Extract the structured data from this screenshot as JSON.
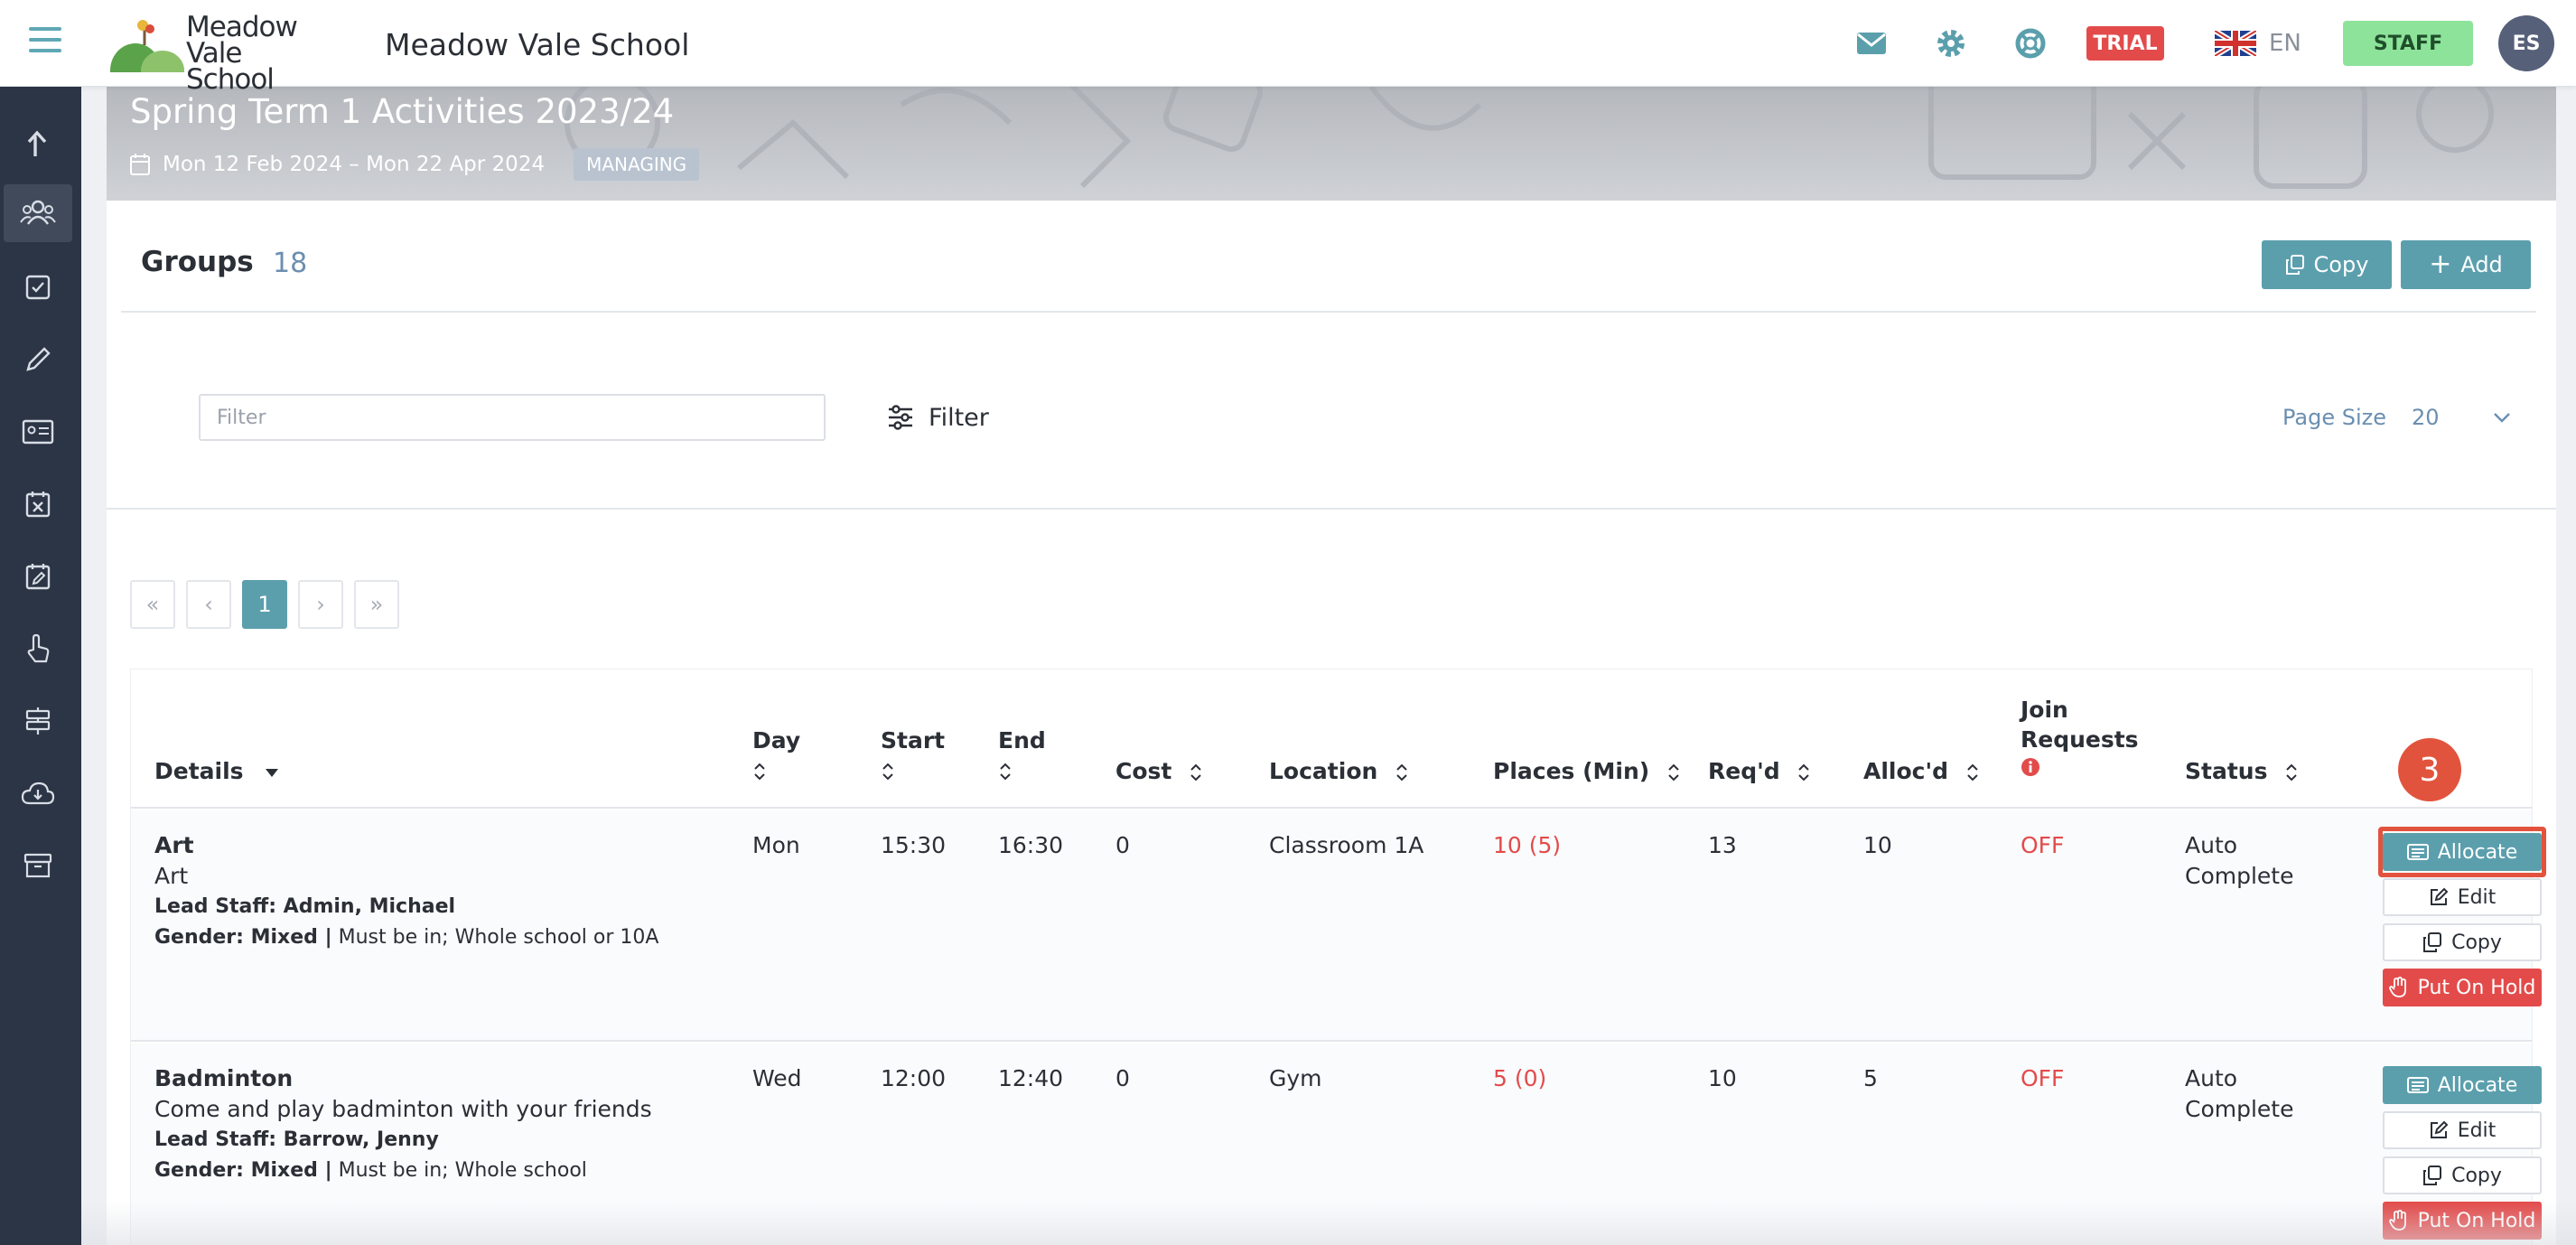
{
  "topbar": {
    "logo_line1": "Meadow",
    "logo_line2": "Vale School",
    "school_name": "Meadow Vale School",
    "trial_label": "TRIAL",
    "language": "EN",
    "staff_label": "STAFF",
    "avatar_initials": "ES"
  },
  "colors": {
    "accent": "#5b9fad",
    "danger": "#e34b4b",
    "sidebar": "#2c3545",
    "staff": "#8ee39b"
  },
  "banner": {
    "title": "Spring Term 1 Activities 2023/24",
    "dates": "Mon 12 Feb 2024 – Mon 22 Apr 2024",
    "badge": "MANAGING"
  },
  "groups": {
    "title": "Groups",
    "count": "18",
    "copy_label": "Copy",
    "add_label": "Add"
  },
  "filter": {
    "placeholder": "Filter",
    "button_label": "Filter",
    "page_size_label": "Page Size",
    "page_size_value": "20"
  },
  "pager": {
    "first": "«",
    "prev": "‹",
    "current": "1",
    "next": "›",
    "last": "»"
  },
  "table": {
    "headers": {
      "details": "Details",
      "day": "Day",
      "start": "Start",
      "end": "End",
      "cost": "Cost",
      "location": "Location",
      "places": "Places (Min)",
      "reqd": "Req'd",
      "allocd": "Alloc'd",
      "join_line1": "Join",
      "join_line2": "Requests",
      "status": "Status"
    },
    "rows": [
      {
        "name": "Art",
        "description": "Art",
        "lead_staff": "Lead Staff: Admin, Michael",
        "gender": "Gender: Mixed |",
        "eligibility": " Must be in; Whole school or 10A",
        "day": "Mon",
        "start": "15:30",
        "end": "16:30",
        "cost": "0",
        "location": "Classroom 1A",
        "places": "10 (5)",
        "reqd": "13",
        "allocd": "10",
        "join": "OFF",
        "status_line1": "Auto",
        "status_line2": "Complete"
      },
      {
        "name": "Badminton",
        "description": "Come and play badminton with your friends",
        "lead_staff": "Lead Staff: Barrow, Jenny",
        "gender": "Gender: Mixed |",
        "eligibility": " Must be in; Whole school",
        "day": "Wed",
        "start": "12:00",
        "end": "12:40",
        "cost": "0",
        "location": "Gym",
        "places": "5 (0)",
        "reqd": "10",
        "allocd": "5",
        "join": "OFF",
        "status_line1": "Auto",
        "status_line2": "Complete"
      }
    ],
    "actions": {
      "allocate": "Allocate",
      "edit": "Edit",
      "copy": "Copy",
      "hold": "Put On Hold"
    }
  },
  "annotation": {
    "step": "3"
  }
}
